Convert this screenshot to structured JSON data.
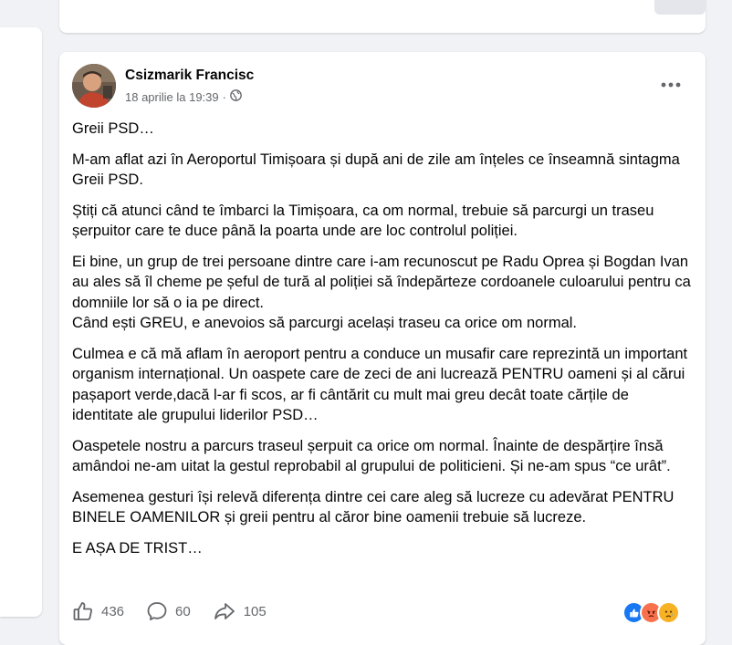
{
  "post": {
    "author": "Csizmarik Francisc",
    "date": "18 aprilie la 19:39",
    "separator": "·",
    "paragraphs": [
      "Greii PSD…",
      "M-am aflat azi în Aeroportul Timișoara și după ani de zile am înțeles ce înseamnă sintagma Greii PSD.",
      "Știți că atunci când te îmbarci la Timișoara, ca om normal, trebuie să parcurgi un traseu șerpuitor care te duce până la poarta unde are loc controlul poliției.",
      "Ei bine, un grup de trei persoane dintre care i-am recunoscut pe Radu Oprea și Bogdan Ivan au ales să îl cheme pe șeful de tură al poliției să îndepărteze cordoanele culoarului pentru ca domniile lor să o ia pe direct.\nCând ești GREU, e anevoios să parcurgi același traseu ca orice om normal.",
      "Culmea e că mă aflam în aeroport pentru a conduce un musafir care reprezintă un important organism internațional. Un oaspete care de zeci de ani lucrează PENTRU oameni și al cărui pașaport verde,dacă l-ar fi scos, ar fi cântărit cu mult mai greu decât toate cărțile de identitate ale grupului liderilor PSD…",
      "Oaspetele nostru  a parcurs traseul șerpuit ca orice om normal. Înainte de despărțire însă amândoi ne-am uitat la gestul reprobabil al grupului de politicieni. Și ne-am spus “ce urât”.",
      "Asemenea gesturi își relevă diferența dintre cei care aleg să lucreze cu adevărat PENTRU BINELE OAMENILOR și greii pentru al căror bine oamenii trebuie să lucreze.",
      "E AȘA DE TRIST…"
    ],
    "likes": "436",
    "comments": "60",
    "shares": "105"
  },
  "icons": {
    "globe": "globe-icon",
    "more": "more-icon",
    "like": "like-icon",
    "comment": "comment-icon",
    "share": "share-icon"
  },
  "colors": {
    "like_blue": "#1877f2",
    "angry_orange": "#f7714c",
    "sad_yellow": "#f7b125",
    "muted": "#65676b"
  }
}
